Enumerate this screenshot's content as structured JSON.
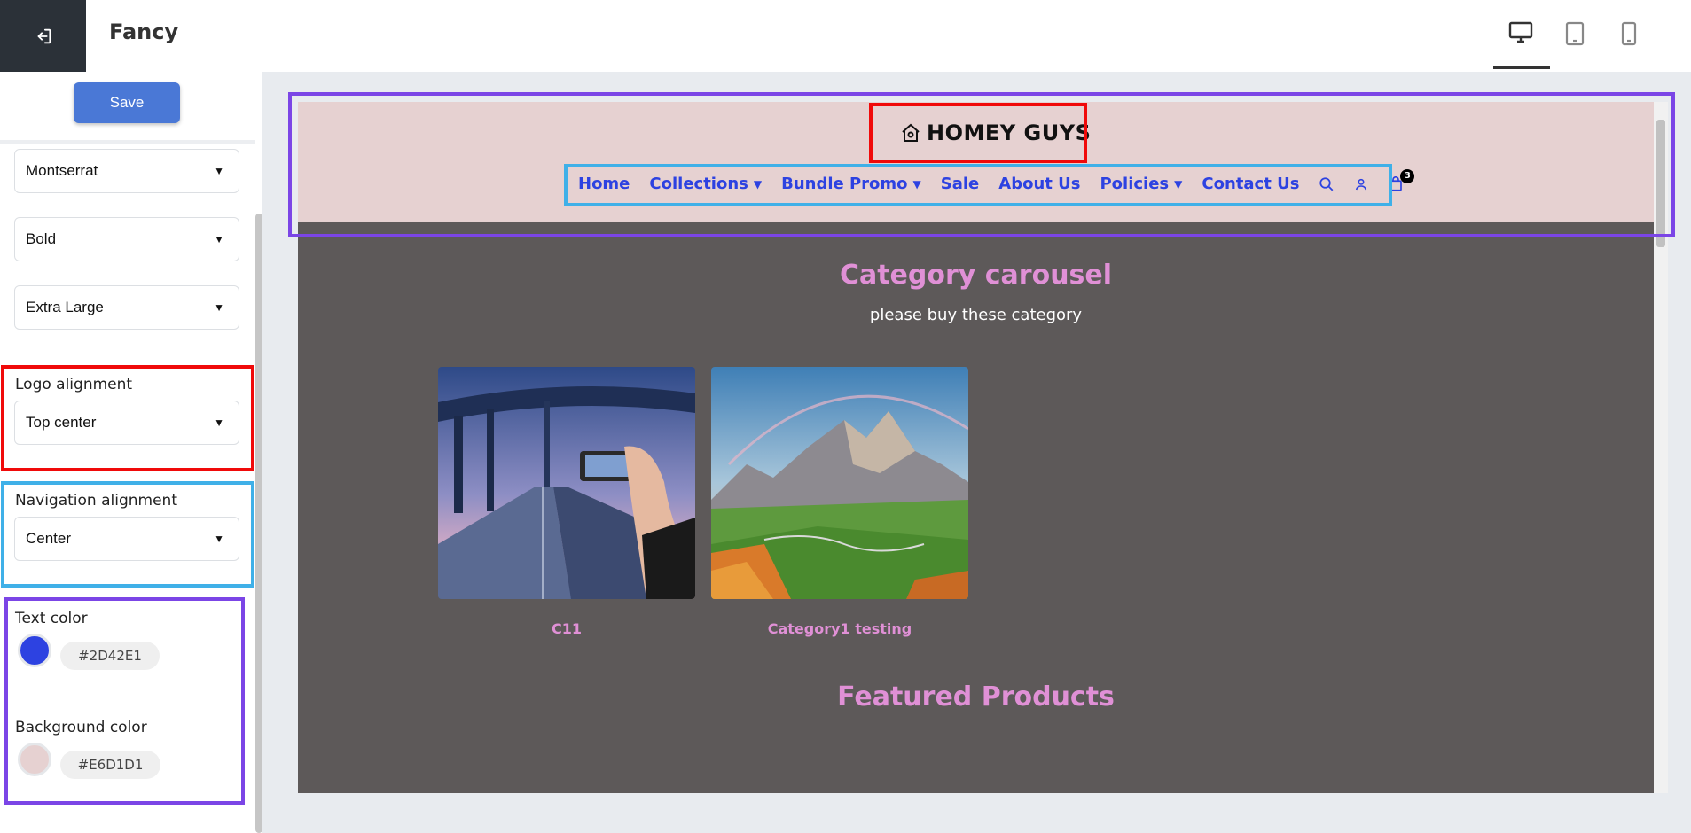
{
  "app": {
    "title": "Fancy"
  },
  "devices": [
    {
      "name": "desktop",
      "active": true
    },
    {
      "name": "tablet",
      "active": false
    },
    {
      "name": "mobile",
      "active": false
    }
  ],
  "sidebar": {
    "save_label": "Save",
    "font_family": "Montserrat",
    "font_weight": "Bold",
    "font_size": "Extra Large",
    "logo_alignment": {
      "label": "Logo alignment",
      "value": "Top center"
    },
    "navigation_alignment": {
      "label": "Navigation alignment",
      "value": "Center"
    },
    "text_color": {
      "label": "Text color",
      "value": "#2D42E1"
    },
    "background_color": {
      "label": "Background color",
      "value": "#E6D1D1"
    }
  },
  "store": {
    "logo_text": "HOMEY GUYS",
    "nav": [
      {
        "label": "Home",
        "dropdown": false
      },
      {
        "label": "Collections",
        "dropdown": true
      },
      {
        "label": "Bundle Promo",
        "dropdown": true
      },
      {
        "label": "Sale",
        "dropdown": false
      },
      {
        "label": "About Us",
        "dropdown": false
      },
      {
        "label": "Policies",
        "dropdown": true
      },
      {
        "label": "Contact Us",
        "dropdown": false
      }
    ],
    "cart_count": "3",
    "carousel": {
      "title": "Category carousel",
      "subtitle": "please buy these category",
      "items": [
        {
          "label": "C11"
        },
        {
          "label": "Category1 testing"
        }
      ]
    },
    "featured_title": "Featured Products"
  },
  "colors": {
    "text": "#2D42E1",
    "header_bg": "#E6D1D1",
    "body_bg": "#5D5959",
    "accent": "#E090D6",
    "save_button": "#4A78D6"
  }
}
